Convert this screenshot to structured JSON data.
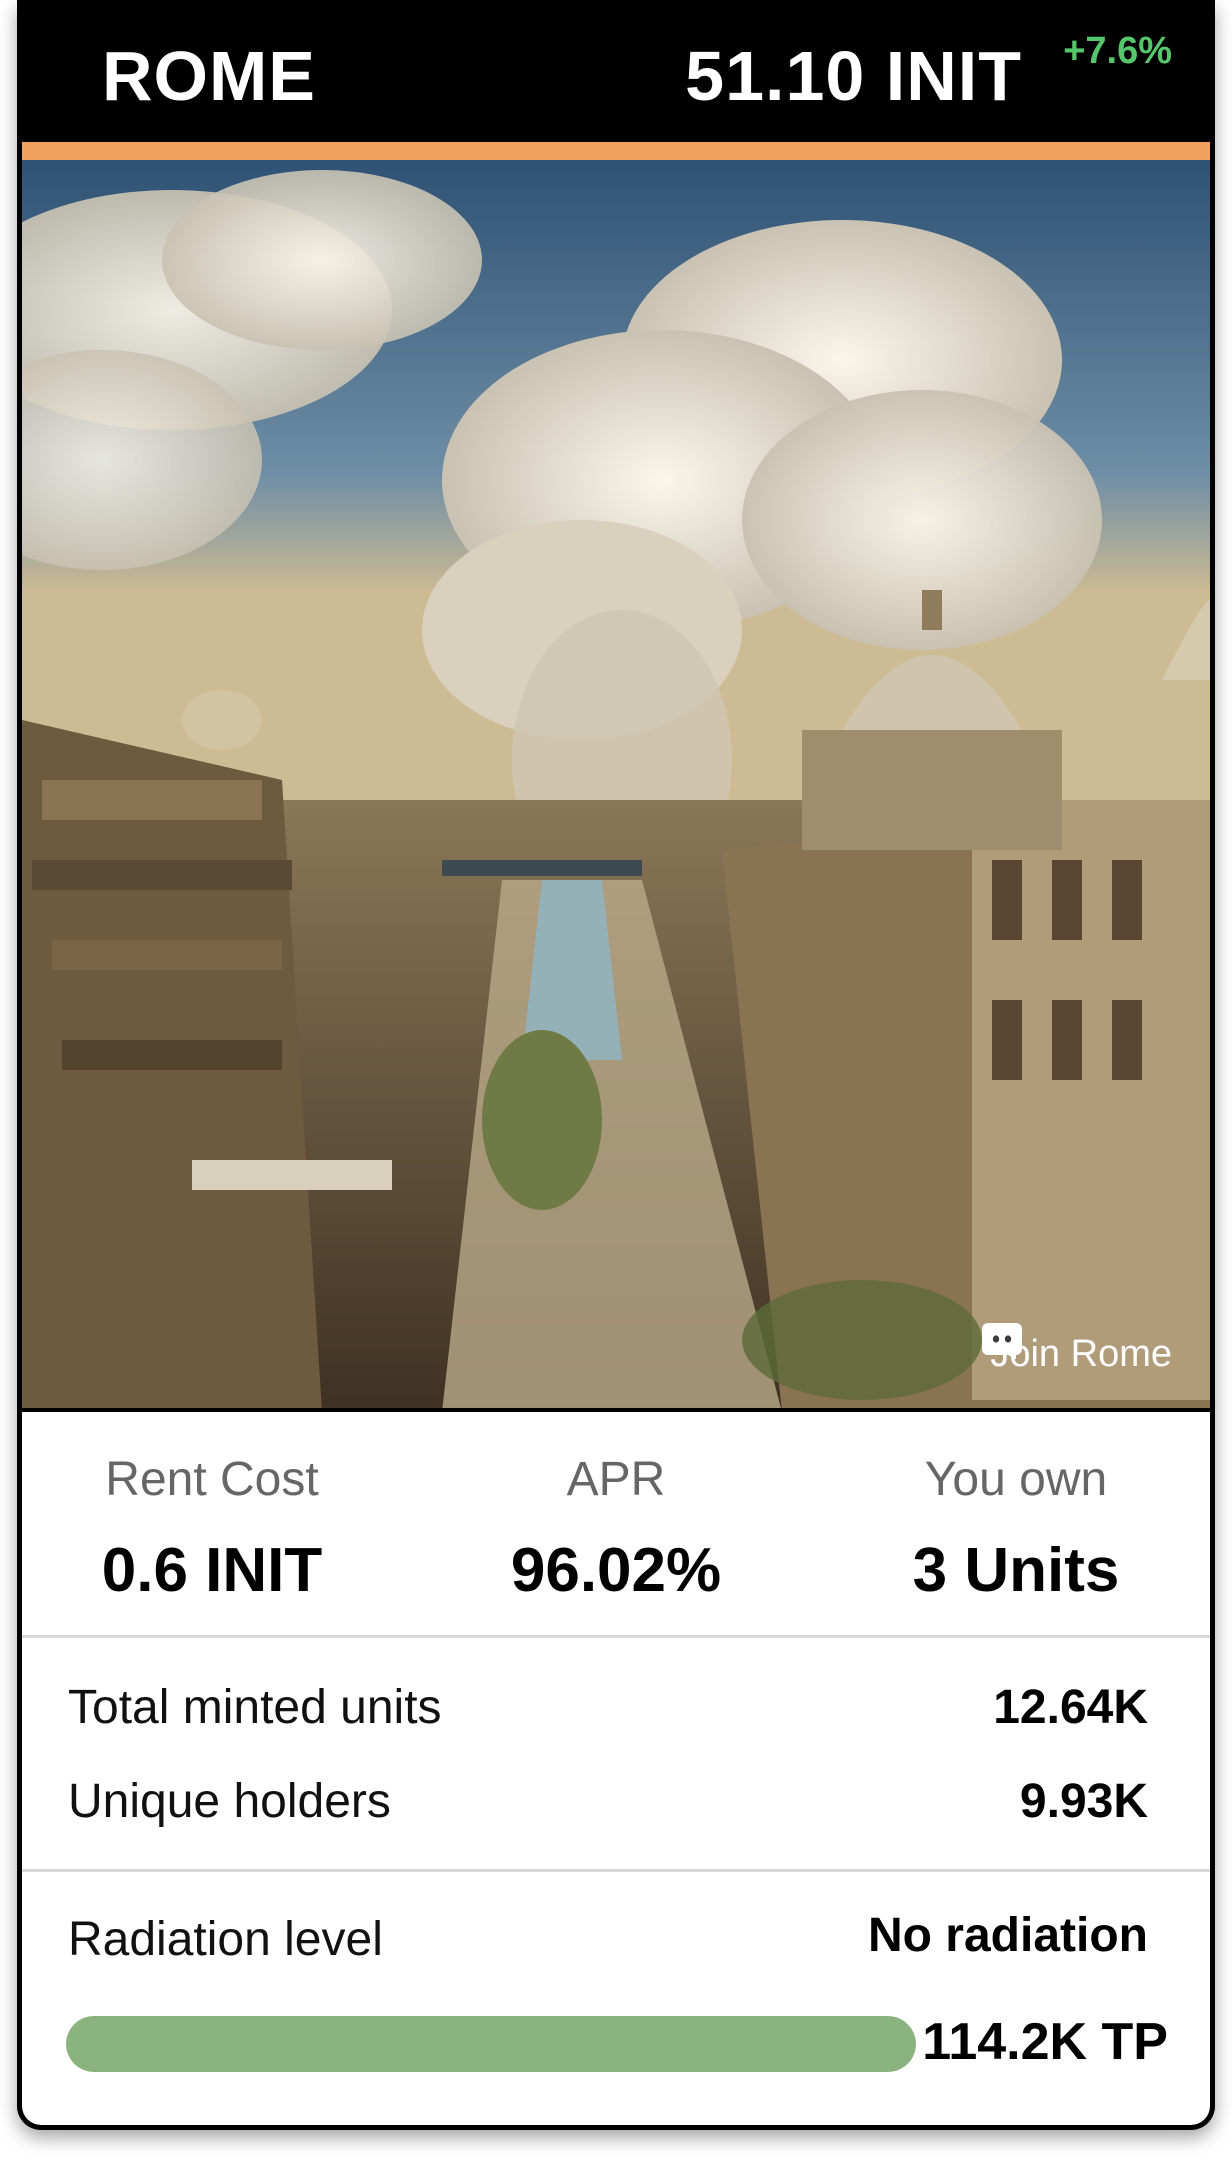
{
  "header": {
    "city": "ROME",
    "price": "51.10 INIT",
    "change": "+7.6%",
    "accent_color": "#f0a15e",
    "change_color": "#56c66c"
  },
  "hero": {
    "join_label": "Join Rome",
    "join_icon": "discord-icon"
  },
  "stats": [
    {
      "label": "Rent Cost",
      "value": "0.6 INIT"
    },
    {
      "label": "APR",
      "value": "96.02%"
    },
    {
      "label": "You own",
      "value": "3 Units"
    }
  ],
  "metrics": [
    {
      "label": "Total minted units",
      "value": "12.64K"
    },
    {
      "label": "Unique holders",
      "value": "9.93K"
    }
  ],
  "radiation": {
    "label": "Radiation level",
    "status": "No radiation",
    "tp": "114.2K TP",
    "progress_fraction": 1.0,
    "bar_color": "#8ab37f"
  }
}
